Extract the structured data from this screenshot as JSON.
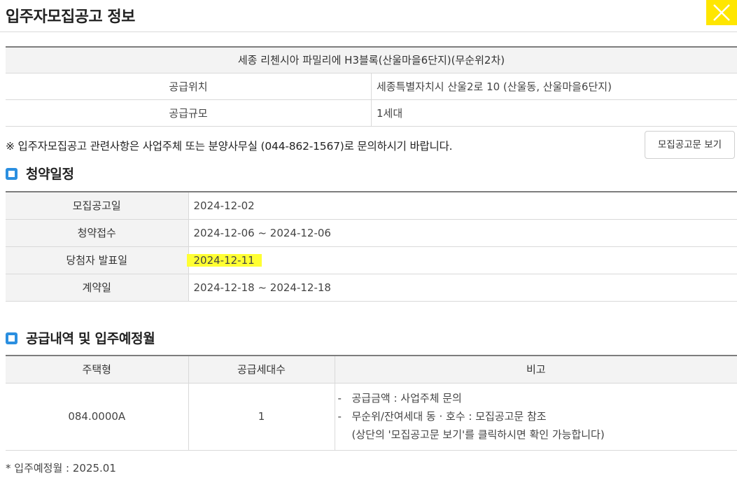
{
  "header": {
    "title": "입주자모집공고 정보"
  },
  "info": {
    "complex_name": "세종 리첸시아 파밀리에 H3블록(산울마을6단지)(무순위2차)",
    "rows": [
      {
        "label": "공급위치",
        "value": "세종특별자치시 산울2로 10 (산울동, 산울마을6단지)"
      },
      {
        "label": "공급규모",
        "value": "1세대"
      }
    ]
  },
  "notice": {
    "text": "※ 입주자모집공고 관련사항은 사업주체 또는 분양사무실 (044-862-1567)로 문의하시기 바랍니다.",
    "button_label": "모집공고문 보기"
  },
  "schedule": {
    "title": "청약일정",
    "rows": [
      {
        "label": "모집공고일",
        "value": "2024-12-02"
      },
      {
        "label": "청약접수",
        "value": "2024-12-06 ~ 2024-12-06"
      },
      {
        "label": "당첨자 발표일",
        "value": "2024-12-11"
      },
      {
        "label": "계약일",
        "value": "2024-12-18 ~ 2024-12-18"
      }
    ]
  },
  "supply": {
    "title": "공급내역 및 입주예정월",
    "headers": [
      "주택형",
      "공급세대수",
      "비고"
    ],
    "row": {
      "housing_type": "084.0000A",
      "units": "1",
      "notes": [
        "공급금액 : 사업주체 문의",
        "무순위/잔여세대 동 · 호수 : 모집공고문 참조",
        "(상단의 '모집공고문 보기'를 클릭하시면 확인 가능합니다)"
      ],
      "note_dash": "-"
    },
    "move_in": "* 입주예정월 : 2025.01"
  },
  "colors": {
    "accent": "#2b8fe0",
    "close_button": "#ffe600",
    "highlight": "#ffff33"
  }
}
